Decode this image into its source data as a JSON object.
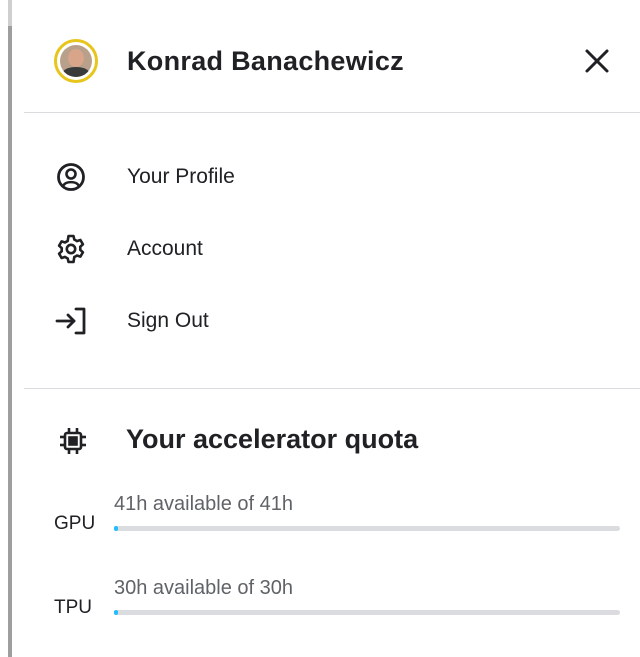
{
  "header": {
    "user_name": "Konrad Banachewicz",
    "close_icon": "close-icon"
  },
  "menu": {
    "items": [
      {
        "label": "Your Profile",
        "icon": "profile-icon"
      },
      {
        "label": "Account",
        "icon": "gear-icon"
      },
      {
        "label": "Sign Out",
        "icon": "sign-out-icon"
      }
    ]
  },
  "quota": {
    "title": "Your accelerator quota",
    "icon": "chip-icon",
    "rows": [
      {
        "kind": "GPU",
        "status": "41h available of 41h",
        "used_fraction": 0.005
      },
      {
        "kind": "TPU",
        "status": "30h available of 30h",
        "used_fraction": 0.005
      }
    ]
  },
  "colors": {
    "accent": "#20beff",
    "avatar_ring": "#e8c51d",
    "divider": "#dadce0"
  }
}
